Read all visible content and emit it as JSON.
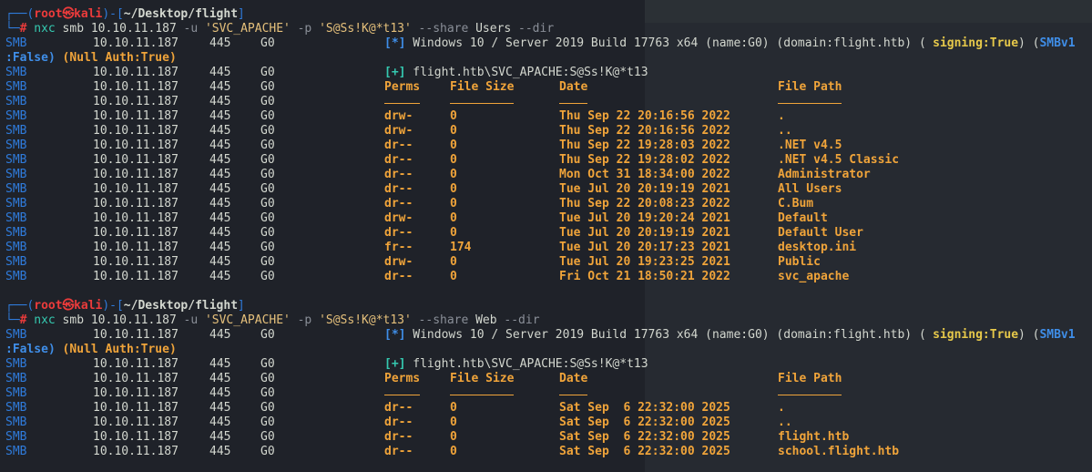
{
  "colors": {
    "background": "#1f2229",
    "smb_blue": "#2f7bdb",
    "orange": "#f0a43a",
    "prompt_red": "#ec3b3b",
    "success_green": "#35c9b0"
  },
  "prompt": {
    "corner_top": "┌──(",
    "user": "root",
    "at_symbol": "㉿",
    "host": "kali",
    "bracket_mid": ")-[",
    "path": "~/Desktop/flight",
    "bracket_close": "]",
    "corner_bottom": "└─",
    "hash": "#"
  },
  "commands": [
    {
      "cmd": "nxc",
      "args1": "smb 10.10.11.187",
      "flag_u": "-u",
      "user_str": "'SVC_APACHE'",
      "flag_p": "-p",
      "pass_str": "'S@Ss!K@*t13'",
      "flag_share": "--share",
      "share": "Users",
      "flag_dir": "--dir"
    },
    {
      "cmd": "nxc",
      "args1": "smb 10.10.11.187",
      "flag_u": "-u",
      "user_str": "'SVC_APACHE'",
      "flag_p": "-p",
      "pass_str": "'S@Ss!K@*t13'",
      "flag_share": "--share",
      "share": "Web",
      "flag_dir": "--dir"
    }
  ],
  "row_common": {
    "proto": "SMB",
    "ip": "10.10.11.187",
    "port": "445",
    "host": "G0"
  },
  "info": {
    "marker": "[*]",
    "text": "Windows 10 / Server 2019 Build 17763 x64 (name:G0) (domain:flight.htb) (",
    "signing": "signing:True",
    "close_open": ") (",
    "smbv1": "SMBv1",
    "wrap": ":False)",
    "null_auth": "(Null Auth:True)"
  },
  "auth": {
    "marker": "[+]",
    "text": "flight.htb\\SVC_APACHE:S@Ss!K@*t13"
  },
  "headers": {
    "perms": "Perms",
    "size": "File Size",
    "date": "Date",
    "path": "File Path"
  },
  "listing_users": [
    {
      "perms": "drw-",
      "size": "0",
      "date": "Thu Sep 22 20:16:56 2022",
      "path": "."
    },
    {
      "perms": "drw-",
      "size": "0",
      "date": "Thu Sep 22 20:16:56 2022",
      "path": ".."
    },
    {
      "perms": "dr--",
      "size": "0",
      "date": "Thu Sep 22 19:28:03 2022",
      "path": ".NET v4.5"
    },
    {
      "perms": "dr--",
      "size": "0",
      "date": "Thu Sep 22 19:28:02 2022",
      "path": ".NET v4.5 Classic"
    },
    {
      "perms": "dr--",
      "size": "0",
      "date": "Mon Oct 31 18:34:00 2022",
      "path": "Administrator"
    },
    {
      "perms": "dr--",
      "size": "0",
      "date": "Tue Jul 20 20:19:19 2021",
      "path": "All Users"
    },
    {
      "perms": "dr--",
      "size": "0",
      "date": "Thu Sep 22 20:08:23 2022",
      "path": "C.Bum"
    },
    {
      "perms": "drw-",
      "size": "0",
      "date": "Tue Jul 20 19:20:24 2021",
      "path": "Default"
    },
    {
      "perms": "dr--",
      "size": "0",
      "date": "Tue Jul 20 20:19:19 2021",
      "path": "Default User"
    },
    {
      "perms": "fr--",
      "size": "174",
      "date": "Tue Jul 20 20:17:23 2021",
      "path": "desktop.ini"
    },
    {
      "perms": "drw-",
      "size": "0",
      "date": "Tue Jul 20 19:23:25 2021",
      "path": "Public"
    },
    {
      "perms": "dr--",
      "size": "0",
      "date": "Fri Oct 21 18:50:21 2022",
      "path": "svc_apache"
    }
  ],
  "listing_web": [
    {
      "perms": "dr--",
      "size": "0",
      "date": "Sat Sep  6 22:32:00 2025",
      "path": "."
    },
    {
      "perms": "dr--",
      "size": "0",
      "date": "Sat Sep  6 22:32:00 2025",
      "path": ".."
    },
    {
      "perms": "dr--",
      "size": "0",
      "date": "Sat Sep  6 22:32:00 2025",
      "path": "flight.htb"
    },
    {
      "perms": "dr--",
      "size": "0",
      "date": "Sat Sep  6 22:32:00 2025",
      "path": "school.flight.htb"
    }
  ]
}
